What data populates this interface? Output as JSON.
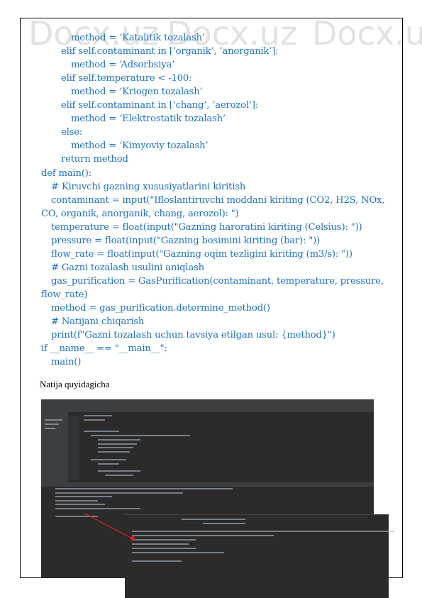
{
  "code_lines": [
    {
      "indent": 3,
      "text": "method = ‘Katalitik tozalash’"
    },
    {
      "indent": 2,
      "text": "elif self.contaminant in [‘organik’, ‘anorganik’]:"
    },
    {
      "indent": 3,
      "text": "method = ‘Adsorbsiya’"
    },
    {
      "indent": 2,
      "text": "elif self.temperature < -100:"
    },
    {
      "indent": 3,
      "text": "method = ‘Kriogen tozalash’"
    },
    {
      "indent": 2,
      "text": "elif self.contaminant in [‘chang‘, ‘aerozol’]:"
    },
    {
      "indent": 3,
      "text": "method = ‘Elektrostatik tozalash’"
    },
    {
      "indent": 2,
      "text": "else:"
    },
    {
      "indent": 3,
      "text": "method = ‘Kimyoviy tozalash’"
    },
    {
      "indent": 2,
      "text": "return method"
    },
    {
      "indent": 0,
      "text": "def main():"
    },
    {
      "indent": 1,
      "text": "# Kiruvchi gazning xususiyatlarini kiritish"
    },
    {
      "indent": 1,
      "text": "contaminant = input(\"Ifloslantiruvchi moddani kiriting (CO2, H2S, NOx,"
    },
    {
      "indent": 0,
      "text": "CO, organik, anorganik, chang, aerozol): \")"
    },
    {
      "indent": 1,
      "text": "temperature = float(input(\"Gazning haroratini kiriting (Celsius): \"))"
    },
    {
      "indent": 1,
      "text": "pressure = float(input(\"Gazning bosimini kiriting (bar): \"))"
    },
    {
      "indent": 1,
      "text": "flow_rate = float(input(\"Gazning oqim tezligini kiriting (m3/s): \"))"
    },
    {
      "indent": 1,
      "text": "# Gazni tozalash usulini aniqlash"
    },
    {
      "indent": 1,
      "text": "gas_purification = GasPurification(contaminant, temperature, pressure,"
    },
    {
      "indent": 0,
      "text": "flow_rate)"
    },
    {
      "indent": 1,
      "text": "method = gas_purification.determine_method()"
    },
    {
      "indent": 1,
      "text": "# Natijani chiqarish"
    },
    {
      "indent": 1,
      "text": "print(f\"Gazni tozalash uchun tavsiya etilgan usul: {method}\")"
    },
    {
      "indent": 0,
      "text": "if __name__ == \"__main__\":"
    },
    {
      "indent": 1,
      "text": "main()"
    }
  ],
  "result_label": "Natija quyidagicha",
  "watermark": "Docx.uz",
  "colors": {
    "code_text": "#1f72c6",
    "ide_background": "#2b2b2b",
    "ide_panel": "#3c3f41",
    "arrow": "#e02020"
  },
  "screenshot": {
    "description_icon": "ide-screenshot"
  }
}
